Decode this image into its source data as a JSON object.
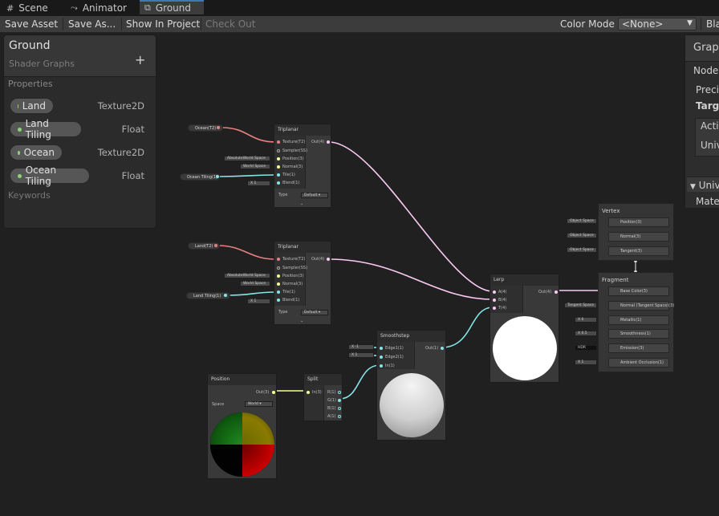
{
  "tabs": [
    {
      "label": "Scene",
      "icon": "grid-icon"
    },
    {
      "label": "Animator",
      "icon": "animator-icon"
    },
    {
      "label": "Ground",
      "icon": "shader-graph-icon"
    }
  ],
  "toolbar": {
    "save_asset": "Save Asset",
    "save_as": "Save As...",
    "show_in_project": "Show In Project",
    "check_out": "Check Out",
    "color_mode_label": "Color Mode",
    "color_mode_value": "<None>",
    "blackboard_partial": "Bla"
  },
  "blackboard": {
    "title": "Ground",
    "subtitle": "Shader Graphs",
    "add": "+",
    "properties_label": "Properties",
    "keywords_label": "Keywords",
    "properties": [
      {
        "name": "Land",
        "type": "Texture2D"
      },
      {
        "name": "Land Tiling",
        "type": "Float"
      },
      {
        "name": "Ocean",
        "type": "Texture2D"
      },
      {
        "name": "Ocean Tiling",
        "type": "Float"
      }
    ]
  },
  "inspector": {
    "title": "Grap",
    "node": "Node",
    "preci": "Preci",
    "targe": "Targe",
    "acti": "Activ",
    "univ": "Univ",
    "univ2": "Univ",
    "mate": "Mate"
  },
  "triplanar_top": {
    "title": "Triplanar",
    "in_ports": [
      "Texture(T2)",
      "Sampler(SS)",
      "Position(3)",
      "Normal(3)",
      "Tile(1)",
      "Blend(1)"
    ],
    "out": "Out(4)",
    "ctx_position": "AbsoluteWorld Space",
    "ctx_normal": "World Space",
    "blend_label": "X",
    "blend_value": "1",
    "type_label": "Type",
    "type_value": "Default",
    "prop_tex": "Ocean(T2)",
    "prop_tile": "Ocean Tiling(1)"
  },
  "triplanar_bot": {
    "title": "Triplanar",
    "in_ports": [
      "Texture(T2)",
      "Sampler(SS)",
      "Position(3)",
      "Normal(3)",
      "Tile(1)",
      "Blend(1)"
    ],
    "out": "Out(4)",
    "ctx_position": "AbsoluteWorld Space",
    "ctx_normal": "World Space",
    "blend_label": "X",
    "blend_value": "1",
    "type_label": "Type",
    "type_value": "Default",
    "prop_tex": "Land(T2)",
    "prop_tile": "Land Tiling(1)"
  },
  "lerp": {
    "title": "Lerp",
    "in_ports": [
      "A(4)",
      "B(4)",
      "T(4)"
    ],
    "out": "Out(4)"
  },
  "smoothstep": {
    "title": "Smoothstep",
    "in_ports": [
      "Edge1(1)",
      "Edge2(1)",
      "In(1)"
    ],
    "out": "Out(1)",
    "e1_label": "X",
    "e1_value": "-1",
    "e2_label": "X",
    "e2_value": "1"
  },
  "position": {
    "title": "Position",
    "out": "Out(3)",
    "space_label": "Space",
    "space_value": "World"
  },
  "split": {
    "title": "Split",
    "in": "In(3)",
    "outs": [
      "R(1)",
      "G(1)",
      "B(1)",
      "A(1)"
    ]
  },
  "vertex": {
    "title": "Vertex",
    "slots": [
      {
        "label": "Position(3)",
        "ctx": "Object Space"
      },
      {
        "label": "Normal(3)",
        "ctx": "Object Space"
      },
      {
        "label": "Tangent(3)",
        "ctx": "Object Space"
      }
    ]
  },
  "fragment": {
    "title": "Fragment",
    "slots": [
      {
        "label": "Base Color(3)",
        "ctx": ""
      },
      {
        "label": "Normal (Tangent Space)(3)",
        "ctx": "Tangent Space"
      },
      {
        "label": "Metallic(1)",
        "ctx": "X  0"
      },
      {
        "label": "Smoothness(1)",
        "ctx": "X  0.5"
      },
      {
        "label": "Emission(3)",
        "ctx": "HDR"
      },
      {
        "label": "Ambient Occlusion(1)",
        "ctx": "X  1"
      }
    ]
  },
  "colors": {
    "texture": "#e88080",
    "float": "#84e4e7",
    "vector3": "#f6ff9a",
    "vector4": "#fbcbf4",
    "accent": "#3a79bb"
  }
}
